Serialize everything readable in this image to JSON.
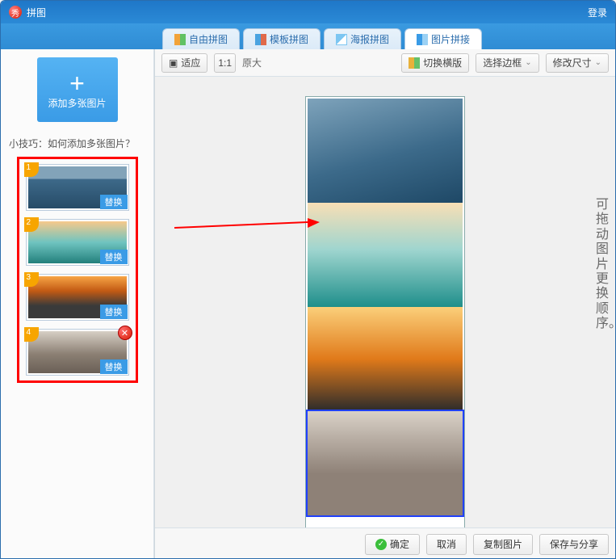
{
  "title": "拼图",
  "logo_char": "秀",
  "login_label": "登录",
  "tabs": [
    {
      "label": "自由拼图",
      "active": false
    },
    {
      "label": "模板拼图",
      "active": false
    },
    {
      "label": "海报拼图",
      "active": false
    },
    {
      "label": "图片拼接",
      "active": true
    }
  ],
  "sidebar": {
    "add_label": "添加多张图片",
    "tip_prefix": "小技巧：",
    "tip_text": "如何添加多张图片？",
    "thumbs": [
      {
        "n": "1",
        "replace": "替换",
        "has_close": false,
        "bg": "linear-gradient(#82a3b9 30%, #3e6a8a 30%, #264b67)"
      },
      {
        "n": "2",
        "replace": "替换",
        "has_close": false,
        "bg": "linear-gradient(#f7c98b, #6fc4c0, #23807c)"
      },
      {
        "n": "3",
        "replace": "替换",
        "has_close": false,
        "bg": "linear-gradient(#f7a545, #c25a13, #3a3a3a 70%)"
      },
      {
        "n": "4",
        "replace": "替换",
        "has_close": true,
        "bg": "linear-gradient(#d6cfc5, #8b7f73 55%, #6a5f56)"
      }
    ]
  },
  "toolbar": {
    "fit": "适应",
    "one_to_one": "1:1",
    "original": "原大",
    "switch_layout": "切换横版",
    "select_border": "选择边框",
    "resize": "修改尺寸"
  },
  "canvas": {
    "panels": [
      {
        "bg": "linear-gradient(165deg,#7ea3bb 0%,#3c6a8a 55%,#1e4866 100%)",
        "selected": false
      },
      {
        "bg": "linear-gradient(#f8dfb5,#9fd5cf 45%,#1f8f8b 100%)",
        "selected": false
      },
      {
        "bg": "linear-gradient(#fbcf7a,#e07a1a 50%,#2b2b2b 100%)",
        "selected": false
      },
      {
        "bg": "linear-gradient(#d9d1c7,#8e8177 60%)",
        "selected": true
      }
    ],
    "drag_hint": "可拖动图片更换顺序。"
  },
  "footer": {
    "ok": "确定",
    "cancel": "取消",
    "copy": "复制图片",
    "save_share": "保存与分享"
  }
}
